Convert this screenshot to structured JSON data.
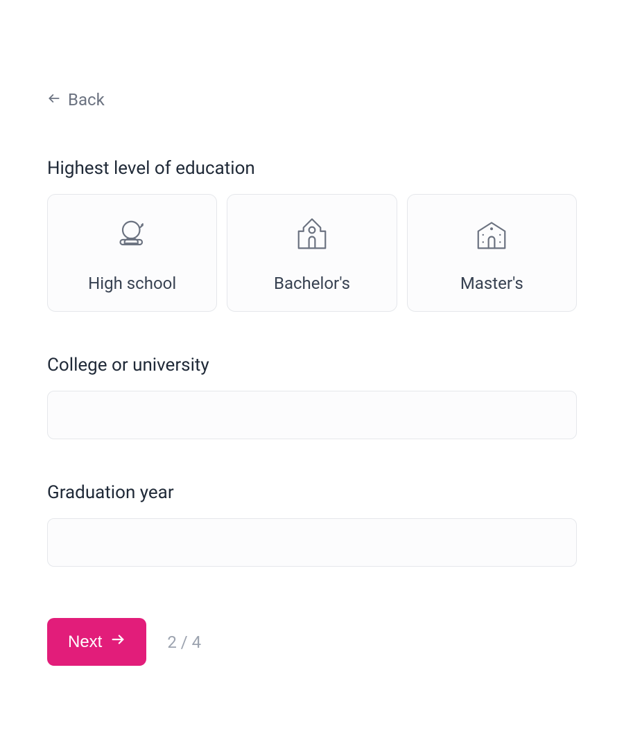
{
  "nav": {
    "back_label": "Back"
  },
  "education": {
    "label": "Highest level of education",
    "options": [
      {
        "label": "High school"
      },
      {
        "label": "Bachelor's"
      },
      {
        "label": "Master's"
      }
    ]
  },
  "college": {
    "label": "College or university",
    "value": ""
  },
  "graduation": {
    "label": "Graduation year",
    "value": ""
  },
  "footer": {
    "next_label": "Next",
    "page_indicator": "2 / 4"
  }
}
